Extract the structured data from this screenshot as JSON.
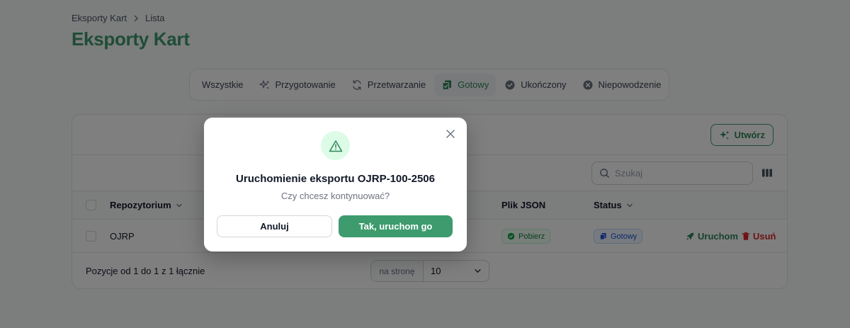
{
  "breadcrumb": {
    "root": "Eksporty Kart",
    "current": "Lista"
  },
  "page_title": "Eksporty Kart",
  "tabs": [
    {
      "label": "Wszystkie",
      "icon": "none"
    },
    {
      "label": "Przygotowanie",
      "icon": "sparkles-icon"
    },
    {
      "label": "Przetwarzanie",
      "icon": "refresh-icon"
    },
    {
      "label": "Gotowy",
      "icon": "document-duplicate-icon",
      "active": true
    },
    {
      "label": "Ukończony",
      "icon": "check-circle-icon"
    },
    {
      "label": "Niepowodzenie",
      "icon": "x-circle-icon"
    }
  ],
  "create_button": "Utwórz",
  "search": {
    "placeholder": "Szukaj"
  },
  "table": {
    "headers": {
      "repository": "Repozytorium",
      "json_file": "Plik JSON",
      "status": "Status"
    },
    "rows": [
      {
        "repository": "OJRP",
        "json_badge": "Pobierz",
        "status_badge": "Gotowy",
        "run": "Uruchom",
        "delete": "Usuń"
      }
    ]
  },
  "footer": {
    "summary": "Pozycje od 1 do 1 z 1 łącznie",
    "per_page_label": "na stronę",
    "per_page_value": "10"
  },
  "modal": {
    "title": "Uruchomienie eksportu OJRP-100-2506",
    "subtitle": "Czy chcesz kontynuować?",
    "cancel": "Anuluj",
    "confirm": "Tak, uruchom go"
  },
  "colors": {
    "brand": "#3d9b6e",
    "danger": "#dc2626",
    "info": "#1d4ed8"
  }
}
